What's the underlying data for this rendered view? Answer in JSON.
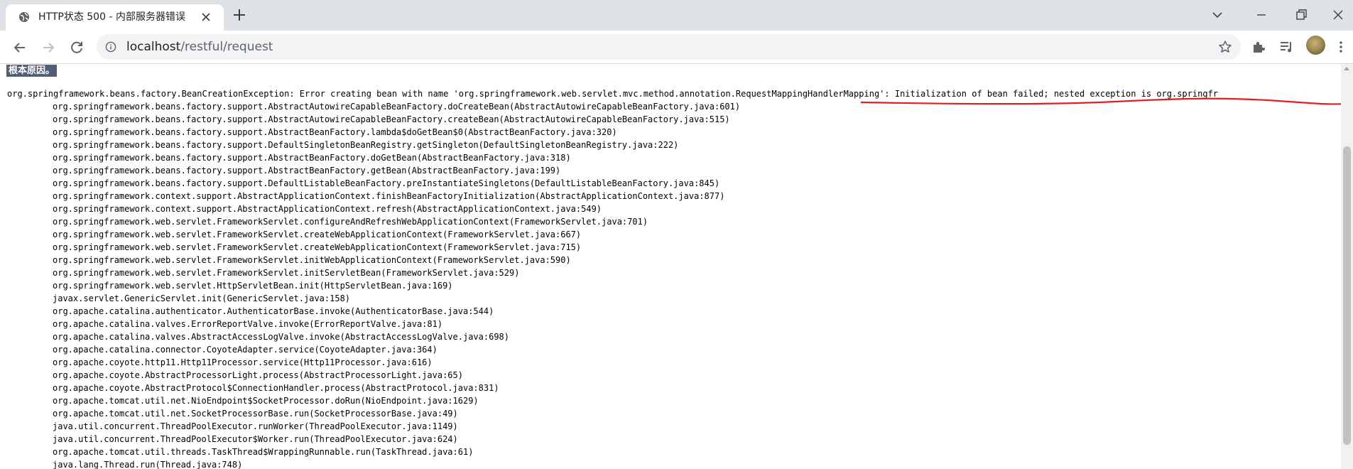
{
  "tab": {
    "title": "HTTP状态 500 - 内部服务器错误"
  },
  "address_bar": {
    "host": "localhost",
    "path": "/restful/request"
  },
  "icons": {
    "tab_favicon": "globe-icon",
    "tab_close": "close-icon",
    "new_tab": "plus-icon",
    "back": "back-arrow-icon",
    "forward": "forward-arrow-icon",
    "reload": "reload-icon",
    "site_info": "info-icon",
    "bookmark": "star-icon",
    "extensions": "puzzle-icon",
    "reading_list": "reading-list-icon",
    "profile": "avatar-icon",
    "menu": "kebab-menu-icon"
  },
  "colors": {
    "heading_bg": "#525d76",
    "annotation_red": "#e02020"
  },
  "error_page": {
    "root_cause_heading": "根本原因。",
    "exception": "org.springframework.beans.factory.BeanCreationException: Error creating bean with name 'org.springframework.web.servlet.mvc.method.annotation.RequestMappingHandlerMapping': Initialization of bean failed; nested exception is org.springfr",
    "frames": [
      "org.springframework.beans.factory.support.AbstractAutowireCapableBeanFactory.doCreateBean(AbstractAutowireCapableBeanFactory.java:601)",
      "org.springframework.beans.factory.support.AbstractAutowireCapableBeanFactory.createBean(AbstractAutowireCapableBeanFactory.java:515)",
      "org.springframework.beans.factory.support.AbstractBeanFactory.lambda$doGetBean$0(AbstractBeanFactory.java:320)",
      "org.springframework.beans.factory.support.DefaultSingletonBeanRegistry.getSingleton(DefaultSingletonBeanRegistry.java:222)",
      "org.springframework.beans.factory.support.AbstractBeanFactory.doGetBean(AbstractBeanFactory.java:318)",
      "org.springframework.beans.factory.support.AbstractBeanFactory.getBean(AbstractBeanFactory.java:199)",
      "org.springframework.beans.factory.support.DefaultListableBeanFactory.preInstantiateSingletons(DefaultListableBeanFactory.java:845)",
      "org.springframework.context.support.AbstractApplicationContext.finishBeanFactoryInitialization(AbstractApplicationContext.java:877)",
      "org.springframework.context.support.AbstractApplicationContext.refresh(AbstractApplicationContext.java:549)",
      "org.springframework.web.servlet.FrameworkServlet.configureAndRefreshWebApplicationContext(FrameworkServlet.java:701)",
      "org.springframework.web.servlet.FrameworkServlet.createWebApplicationContext(FrameworkServlet.java:667)",
      "org.springframework.web.servlet.FrameworkServlet.createWebApplicationContext(FrameworkServlet.java:715)",
      "org.springframework.web.servlet.FrameworkServlet.initWebApplicationContext(FrameworkServlet.java:590)",
      "org.springframework.web.servlet.FrameworkServlet.initServletBean(FrameworkServlet.java:529)",
      "org.springframework.web.servlet.HttpServletBean.init(HttpServletBean.java:169)",
      "javax.servlet.GenericServlet.init(GenericServlet.java:158)",
      "org.apache.catalina.authenticator.AuthenticatorBase.invoke(AuthenticatorBase.java:544)",
      "org.apache.catalina.valves.ErrorReportValve.invoke(ErrorReportValve.java:81)",
      "org.apache.catalina.valves.AbstractAccessLogValve.invoke(AbstractAccessLogValve.java:698)",
      "org.apache.catalina.connector.CoyoteAdapter.service(CoyoteAdapter.java:364)",
      "org.apache.coyote.http11.Http11Processor.service(Http11Processor.java:616)",
      "org.apache.coyote.AbstractProcessorLight.process(AbstractProcessorLight.java:65)",
      "org.apache.coyote.AbstractProtocol$ConnectionHandler.process(AbstractProtocol.java:831)",
      "org.apache.tomcat.util.net.NioEndpoint$SocketProcessor.doRun(NioEndpoint.java:1629)",
      "org.apache.tomcat.util.net.SocketProcessorBase.run(SocketProcessorBase.java:49)",
      "java.util.concurrent.ThreadPoolExecutor.runWorker(ThreadPoolExecutor.java:1149)",
      "java.util.concurrent.ThreadPoolExecutor$Worker.run(ThreadPoolExecutor.java:624)",
      "org.apache.tomcat.util.threads.TaskThread$WrappingRunnable.run(TaskThread.java:61)",
      "java.lang.Thread.run(Thread.java:748)"
    ]
  }
}
